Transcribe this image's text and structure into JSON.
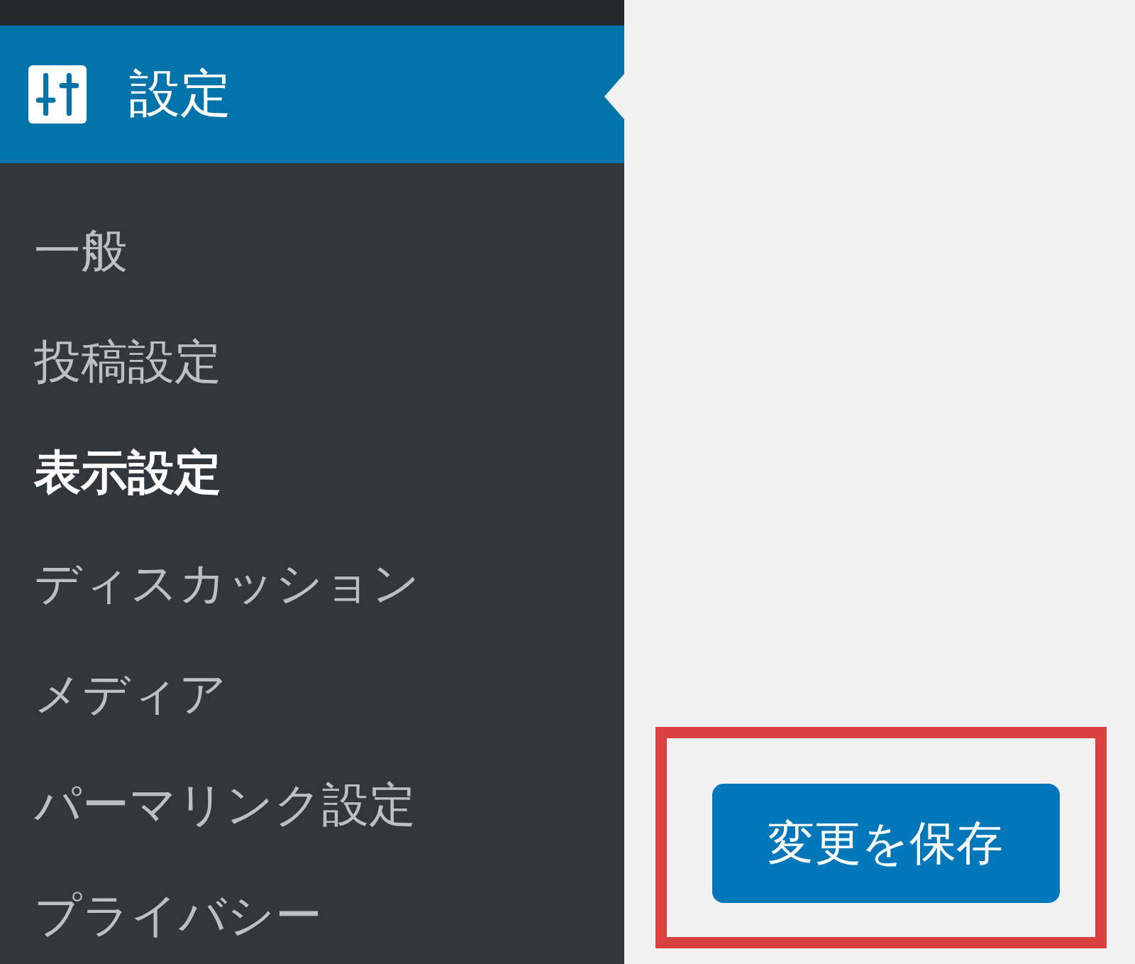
{
  "sidebar": {
    "active_menu": {
      "label": "設定",
      "selected": true
    },
    "submenu": [
      {
        "label": "一般",
        "selected": false
      },
      {
        "label": "投稿設定",
        "selected": false
      },
      {
        "label": "表示設定",
        "selected": true
      },
      {
        "label": "ディスカッション",
        "selected": false
      },
      {
        "label": "メディア",
        "selected": false
      },
      {
        "label": "パーマリンク設定",
        "selected": false
      },
      {
        "label": "プライバシー",
        "selected": false
      }
    ]
  },
  "save_button": {
    "label": "変更を保存",
    "highlighted": true
  }
}
